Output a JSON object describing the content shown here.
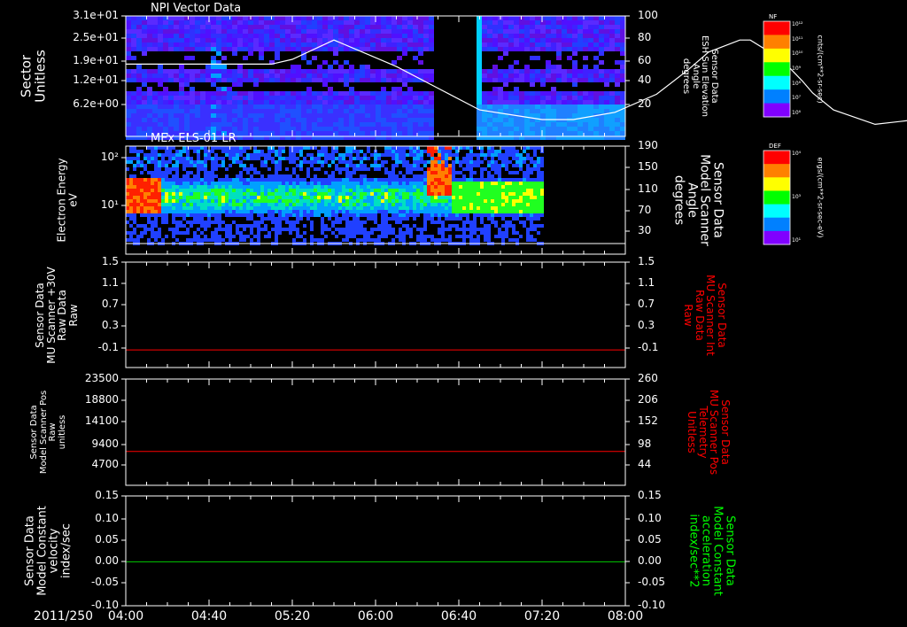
{
  "date_label": "2011/250",
  "x_ticks": [
    "04:00",
    "04:40",
    "05:20",
    "06:00",
    "06:40",
    "07:20",
    "08:00"
  ],
  "colorbars": [
    {
      "title": "NF",
      "unit": "cnts/(cm**2-sr-sec)",
      "ticks": [
        "10¹²",
        "10¹¹",
        "10¹⁰",
        "10⁹",
        "10⁸",
        "10⁷",
        "10⁶"
      ],
      "palette": [
        "#ff0000",
        "#ff8000",
        "#ffff00",
        "#00ff00",
        "#00ffff",
        "#0080ff",
        "#8000ff"
      ]
    },
    {
      "title": "DEF",
      "unit": "ergs/(cm**2-sr-sec-eV)",
      "ticks": [
        "10⁴",
        "10³",
        "10¹"
      ],
      "palette": [
        "#ff0000",
        "#ff8000",
        "#ffff00",
        "#00ff00",
        "#00ffff",
        "#0080ff",
        "#8000ff"
      ]
    }
  ],
  "chart_data": [
    {
      "type": "heatmap",
      "title": "NPI Vector Data",
      "ylabel": [
        "Sector",
        "Unitless"
      ],
      "yticks": [
        "3.1e+01",
        "2.5e+01",
        "1.9e+01",
        "1.2e+01",
        "6.2e+00"
      ],
      "y2label": [
        "Sensor Data",
        "ESH Sun Elevation",
        "Angle",
        "degrees"
      ],
      "y2ticks": [
        "100",
        "80",
        "60",
        "40",
        "20"
      ],
      "y2lim": [
        0,
        100
      ],
      "xlim": [
        "04:00",
        "08:00"
      ],
      "data_gap": [
        "06:28",
        "06:47"
      ],
      "overlay_line": {
        "color": "#ffffff",
        "x_min": [
          0,
          70,
          80,
          100,
          130,
          150,
          170,
          200,
          215,
          235,
          255,
          270,
          280,
          295,
          300,
          315,
          325,
          330,
          340,
          360,
          380,
          400,
          440,
          480,
          520,
          560
        ],
        "y": [
          60,
          60,
          64,
          80,
          58,
          40,
          22,
          14,
          14,
          20,
          35,
          55,
          70,
          80,
          80,
          64,
          46,
          36,
          22,
          10,
          14,
          60,
          60,
          60,
          60,
          60
        ]
      }
    },
    {
      "type": "heatmap",
      "title": "MEx ELS-01 LR",
      "ylabel": [
        "Electron Energy",
        "eV"
      ],
      "yticks": [
        "10²",
        "10¹"
      ],
      "y2label": [
        "Sensor Data",
        "Model Scanner",
        "Angle",
        "degrees"
      ],
      "y2ticks": [
        "190",
        "150",
        "110",
        "70",
        "30"
      ],
      "y2lim": [
        0,
        190
      ],
      "xlim": [
        "04:00",
        "08:00"
      ],
      "data_end": "07:20",
      "overlay_line": {
        "color": "#ffffff",
        "y_const": 0
      }
    },
    {
      "type": "line",
      "ylabel": [
        "Sensor Data",
        "MU Scanner +30V",
        "Raw Data",
        "Raw"
      ],
      "yticks": [
        "1.5",
        "1.1",
        "0.7",
        "0.3",
        "-0.1"
      ],
      "ylim": [
        -0.3,
        1.5
      ],
      "y2label": [
        "Sensor Data",
        "MU Scanner Int",
        "Raw Data",
        "Raw"
      ],
      "y2ticks": [
        "1.5",
        "1.1",
        "0.7",
        "0.3",
        "-0.1"
      ],
      "y2_color": "#ff0000",
      "series": [
        {
          "color": "#ff0000",
          "y_const": 0.0
        }
      ]
    },
    {
      "type": "line",
      "ylabel": [
        "Sensor Data",
        "Model Scanner Pos",
        "Raw",
        "unitless"
      ],
      "yticks": [
        "23500",
        "18800",
        "14100",
        "9400",
        "4700"
      ],
      "ylim": [
        0,
        23500
      ],
      "y2label": [
        "Sensor Data",
        "MU Scanner Pos",
        "Telemetry",
        "Unitless"
      ],
      "y2ticks": [
        "260",
        "206",
        "152",
        "98",
        "44"
      ],
      "y2_color": "#ff0000",
      "series": [
        {
          "color": "#ff0000",
          "y_const": 7500
        }
      ]
    },
    {
      "type": "line",
      "ylabel": [
        "Sensor Data",
        "Model Constant",
        "velocity",
        "index/sec"
      ],
      "yticks": [
        "0.15",
        "0.10",
        "0.05",
        "0.00",
        "-0.05",
        "-0.10"
      ],
      "ylim": [
        -0.1,
        0.15
      ],
      "y2label": [
        "Sensor Data",
        "Model Constant",
        "acceleration",
        "index/sec**2"
      ],
      "y2ticks": [
        "0.15",
        "0.10",
        "0.05",
        "0.00",
        "-0.05",
        "-0.10"
      ],
      "y2_color": "#00ff00",
      "series": [
        {
          "color": "#00cc00",
          "y_const": 0.0
        }
      ]
    }
  ]
}
